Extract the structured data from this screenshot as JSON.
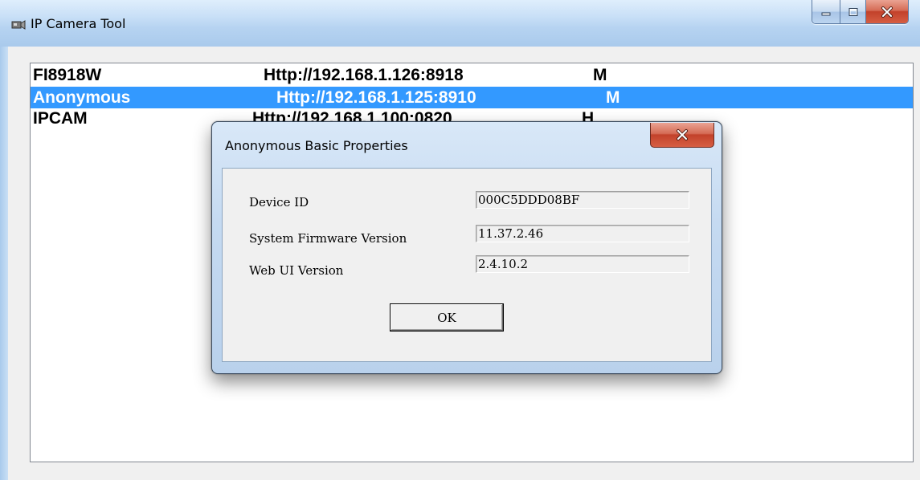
{
  "window": {
    "title": "IP Camera Tool",
    "controls": {
      "minimize": "minimize-icon",
      "maximize": "maximize-icon",
      "close": "close-icon"
    }
  },
  "devices": [
    {
      "name": "FI8918W",
      "url": "Http://192.168.1.126:8918",
      "type": "M",
      "selected": false
    },
    {
      "name": "Anonymous",
      "url": "Http://192.168.1.125:8910",
      "type": "M",
      "selected": true
    },
    {
      "name": "IPCAM",
      "url": "Http://192.168.1.100:0820",
      "type": "H",
      "selected": false
    }
  ],
  "dialog": {
    "title": "Anonymous Basic Properties",
    "fields": [
      {
        "label": "Device ID",
        "value": "000C5DDD08BF"
      },
      {
        "label": "System Firmware Version",
        "value": "11.37.2.46"
      },
      {
        "label": "Web UI Version",
        "value": "2.4.10.2"
      }
    ],
    "ok_label": "OK"
  },
  "colors": {
    "selection": "#3399ff",
    "close_red": "#c2412a",
    "titlebar": "#b6d3f1"
  }
}
